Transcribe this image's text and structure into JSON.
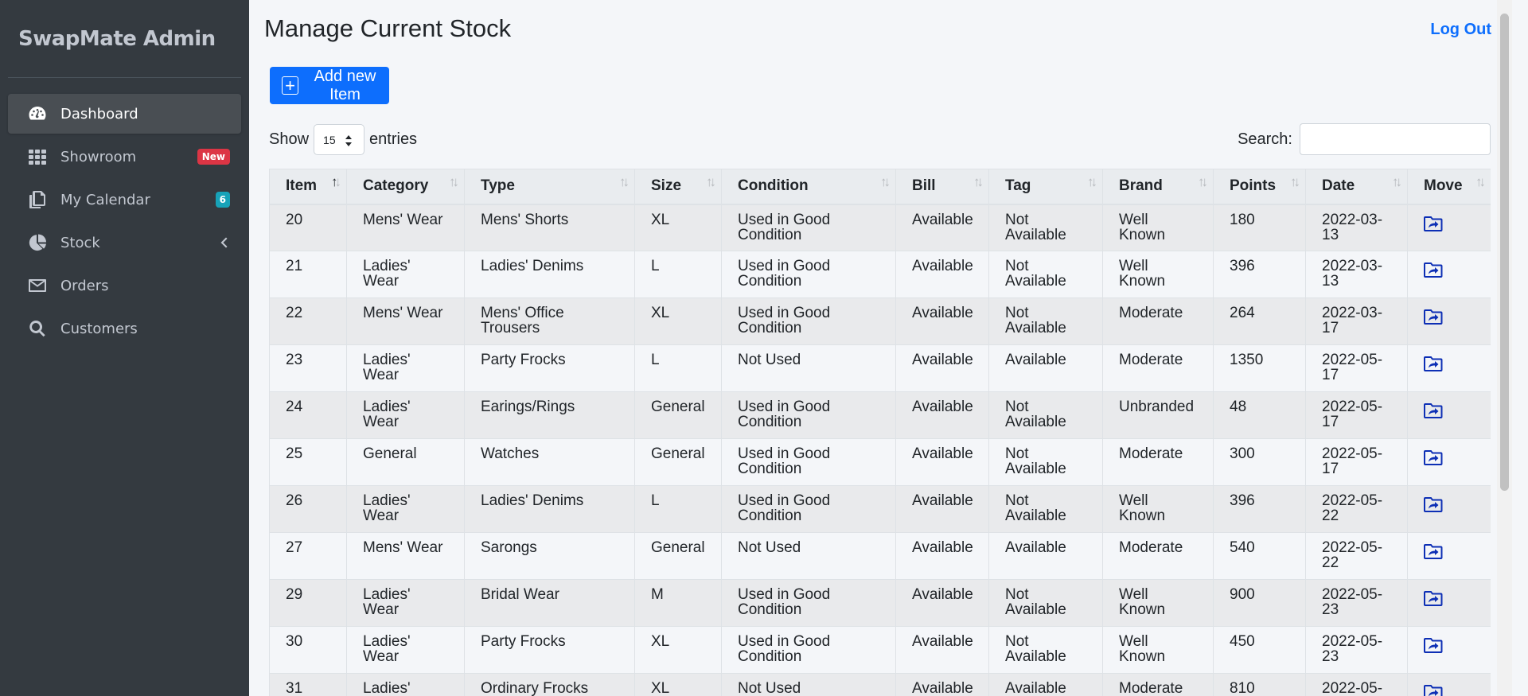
{
  "app": {
    "brand": "SwapMate Admin"
  },
  "sidebar": {
    "items": [
      {
        "label": "Dashboard",
        "icon": "tachometer-icon",
        "active": true
      },
      {
        "label": "Showroom",
        "icon": "grid-icon",
        "badge": "New"
      },
      {
        "label": "My Calendar",
        "icon": "copy-icon",
        "badge": "6"
      },
      {
        "label": "Stock",
        "icon": "pie-chart-icon"
      },
      {
        "label": "Orders",
        "icon": "envelope-icon"
      },
      {
        "label": "Customers",
        "icon": "search-icon"
      }
    ]
  },
  "header": {
    "title": "Manage Current Stock",
    "logout": "Log Out"
  },
  "toolbar": {
    "add_label": "Add new Item",
    "add_icon": "plus-square-icon"
  },
  "length_control": {
    "prefix": "Show",
    "value": "15",
    "suffix": "entries"
  },
  "search": {
    "label": "Search:",
    "value": ""
  },
  "table": {
    "columns": [
      "Item",
      "Category",
      "Type",
      "Size",
      "Condition",
      "Bill",
      "Tag",
      "Brand",
      "Points",
      "Date",
      "Move"
    ],
    "rows": [
      [
        "20",
        "Mens' Wear",
        "Mens' Shorts",
        "XL",
        "Used in Good Condition",
        "Available",
        "Not Available",
        "Well Known",
        "180",
        "2022-03-13"
      ],
      [
        "21",
        "Ladies' Wear",
        "Ladies' Denims",
        "L",
        "Used in Good Condition",
        "Available",
        "Not Available",
        "Well Known",
        "396",
        "2022-03-13"
      ],
      [
        "22",
        "Mens' Wear",
        "Mens' Office Trousers",
        "XL",
        "Used in Good Condition",
        "Available",
        "Not Available",
        "Moderate",
        "264",
        "2022-03-17"
      ],
      [
        "23",
        "Ladies' Wear",
        "Party Frocks",
        "L",
        "Not Used",
        "Available",
        "Available",
        "Moderate",
        "1350",
        "2022-05-17"
      ],
      [
        "24",
        "Ladies' Wear",
        "Earings/Rings",
        "General",
        "Used in Good Condition",
        "Available",
        "Not Available",
        "Unbranded",
        "48",
        "2022-05-17"
      ],
      [
        "25",
        "General",
        "Watches",
        "General",
        "Used in Good Condition",
        "Available",
        "Not Available",
        "Moderate",
        "300",
        "2022-05-17"
      ],
      [
        "26",
        "Ladies' Wear",
        "Ladies' Denims",
        "L",
        "Used in Good Condition",
        "Available",
        "Not Available",
        "Well Known",
        "396",
        "2022-05-22"
      ],
      [
        "27",
        "Mens' Wear",
        "Sarongs",
        "General",
        "Not Used",
        "Available",
        "Available",
        "Moderate",
        "540",
        "2022-05-22"
      ],
      [
        "29",
        "Ladies' Wear",
        "Bridal Wear",
        "M",
        "Used in Good Condition",
        "Available",
        "Not Available",
        "Well Known",
        "900",
        "2022-05-23"
      ],
      [
        "30",
        "Ladies' Wear",
        "Party Frocks",
        "XL",
        "Used in Good Condition",
        "Available",
        "Not Available",
        "Well Known",
        "450",
        "2022-05-23"
      ],
      [
        "31",
        "Ladies' Wear",
        "Ordinary Frocks",
        "XL",
        "Not Used",
        "Available",
        "Available",
        "Moderate",
        "810",
        "2022-05-"
      ]
    ],
    "sort_glyph": "↑↓"
  },
  "colors": {
    "sidebar_bg": "#343a40",
    "primary": "#0d6efd",
    "badge_new": "#dc3545",
    "badge_count": "#17a2b8",
    "move_icon": "#0d2fb5"
  }
}
